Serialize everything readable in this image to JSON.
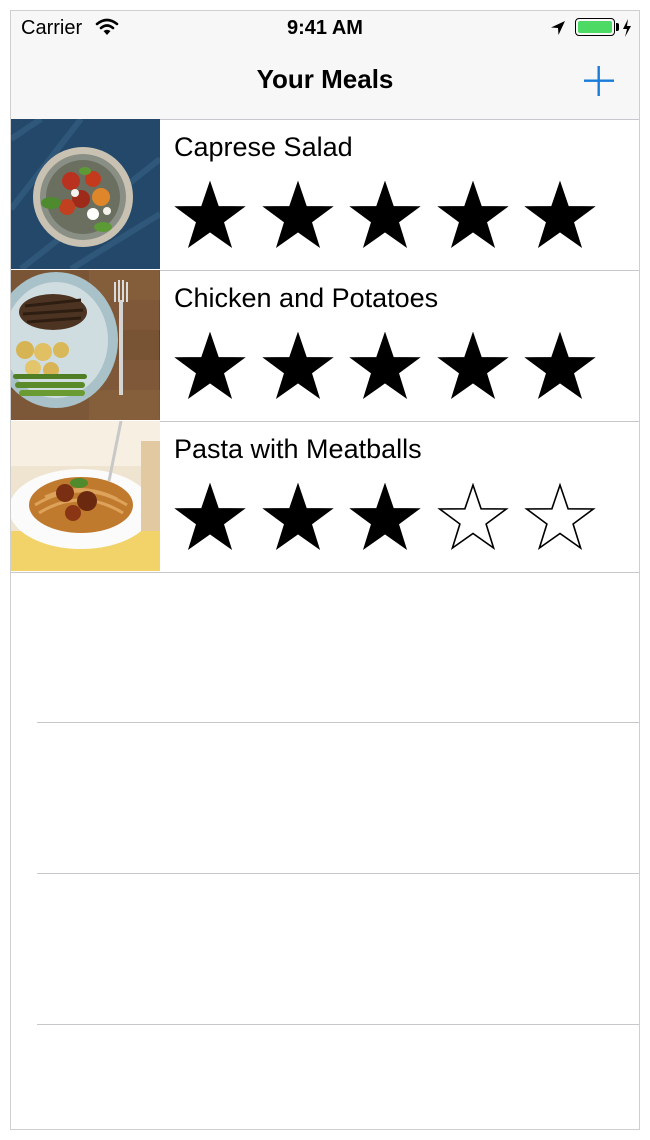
{
  "status_bar": {
    "carrier": "Carrier",
    "time": "9:41 AM",
    "battery_level": 1.0,
    "icons": [
      "wifi-icon",
      "location-arrow-icon",
      "battery-icon",
      "charging-bolt-icon"
    ]
  },
  "nav": {
    "title": "Your Meals",
    "add_icon": "plus-icon"
  },
  "colors": {
    "tint": "#1a7cd9",
    "battery_green": "#4cd964",
    "separator": "#c8c8cc",
    "bar_background": "#f7f7f7"
  },
  "meals": [
    {
      "name": "Caprese Salad",
      "rating": 5,
      "max_rating": 5,
      "photo": "caprese-salad-photo"
    },
    {
      "name": "Chicken and Potatoes",
      "rating": 5,
      "max_rating": 5,
      "photo": "chicken-potatoes-photo"
    },
    {
      "name": "Pasta with Meatballs",
      "rating": 3,
      "max_rating": 5,
      "photo": "pasta-meatballs-photo"
    }
  ]
}
